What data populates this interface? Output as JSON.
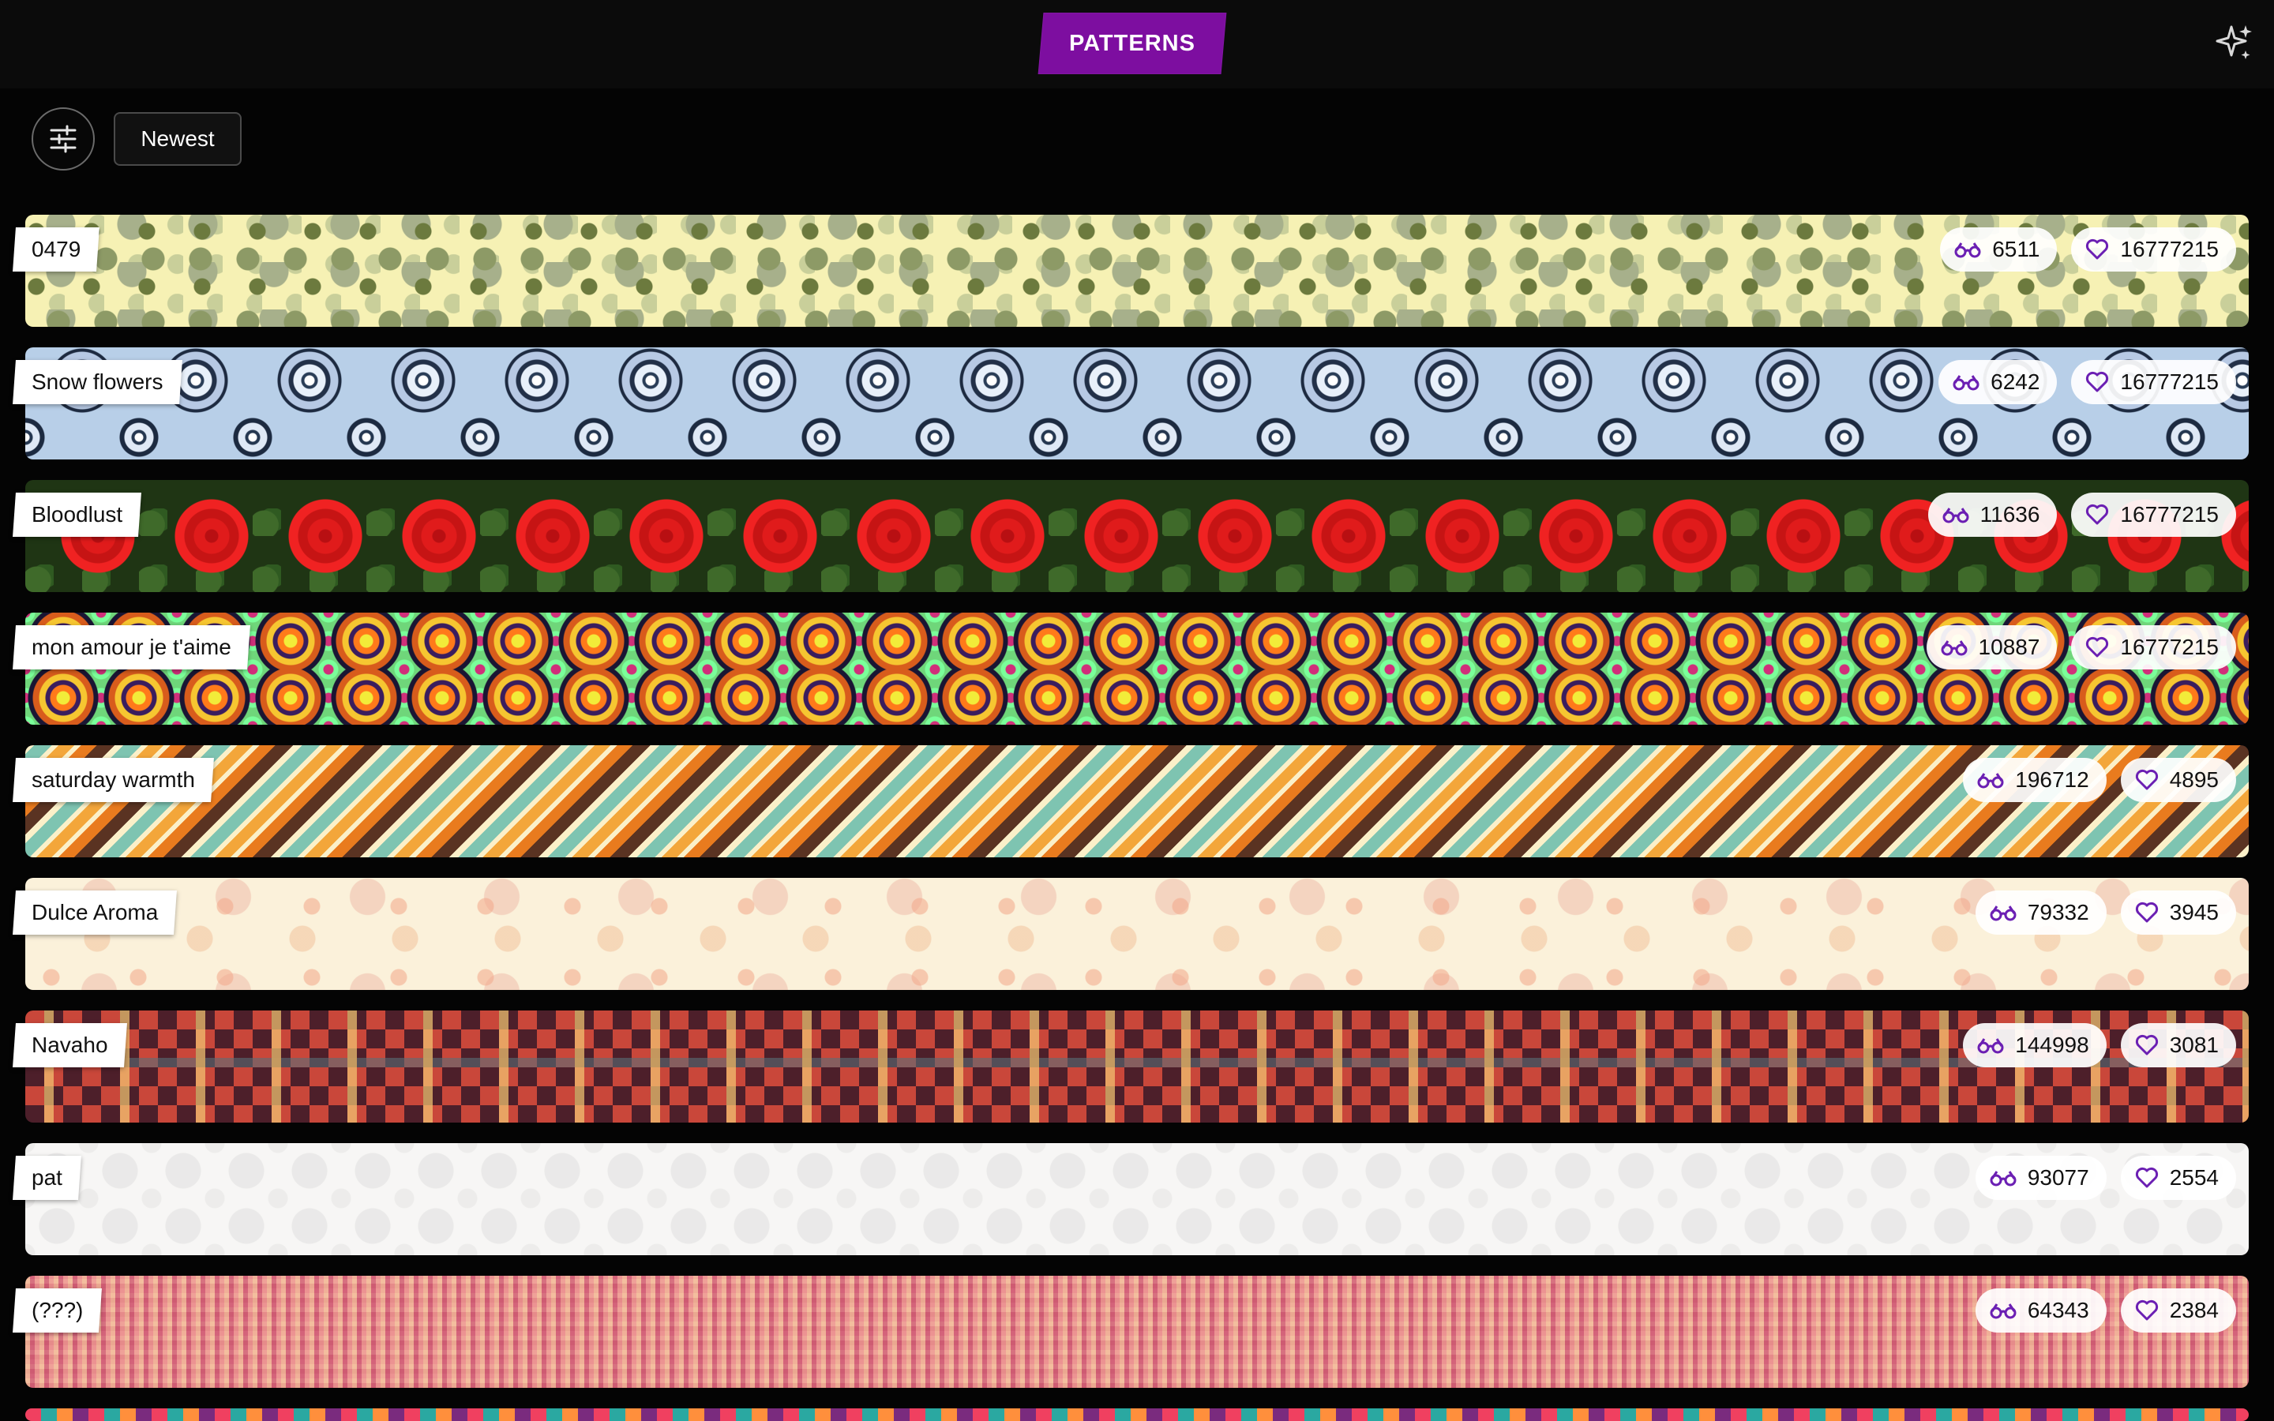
{
  "app": {
    "brand": "PATTERNS"
  },
  "toolbar": {
    "sort_label": "Newest"
  },
  "icons": {
    "filter": "sliders-icon",
    "sparkle": "sparkle-icon",
    "views": "glasses-icon",
    "likes": "heart-icon"
  },
  "colors": {
    "accent": "#7d0ea0",
    "icon_purple": "#6b1fb3",
    "topbar": "#0b0b0b",
    "background": "#040404"
  },
  "patterns": [
    {
      "name": "0479",
      "views": "6511",
      "likes": "16777215"
    },
    {
      "name": "Snow flowers",
      "views": "6242",
      "likes": "16777215"
    },
    {
      "name": "Bloodlust",
      "views": "11636",
      "likes": "16777215"
    },
    {
      "name": "mon amour je t'aime",
      "views": "10887",
      "likes": "16777215"
    },
    {
      "name": "saturday warmth",
      "views": "196712",
      "likes": "4895"
    },
    {
      "name": "Dulce Aroma",
      "views": "79332",
      "likes": "3945"
    },
    {
      "name": "Navaho",
      "views": "144998",
      "likes": "3081"
    },
    {
      "name": "pat",
      "views": "93077",
      "likes": "2554"
    },
    {
      "name": "(???)",
      "views": "64343",
      "likes": "2384"
    }
  ]
}
